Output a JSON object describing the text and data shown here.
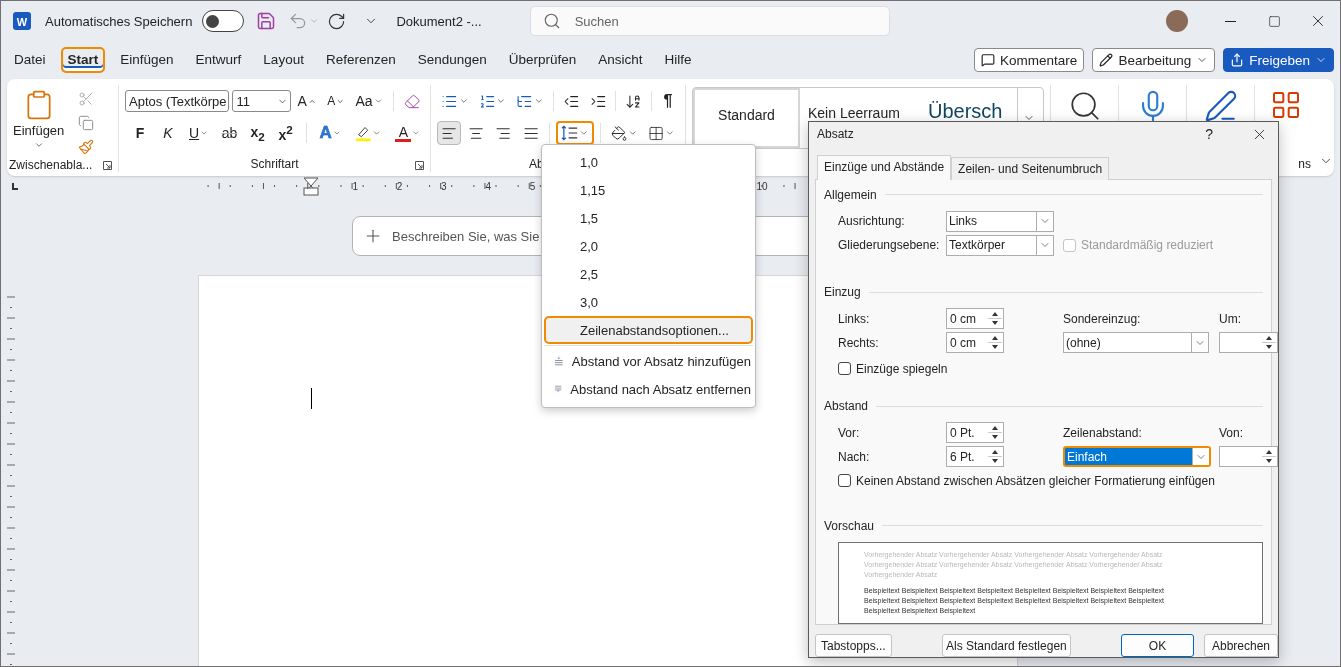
{
  "title_bar": {
    "logo_letter": "W",
    "autosave_label": "Automatisches Speichern",
    "autosave_on": false,
    "document_title": "Dokument2 -...",
    "search_placeholder": "Suchen"
  },
  "tabs": [
    {
      "label": "Datei",
      "selected": false,
      "highlighted": false
    },
    {
      "label": "Start",
      "selected": true,
      "highlighted": true
    },
    {
      "label": "Einfügen",
      "selected": false,
      "highlighted": false
    },
    {
      "label": "Entwurf",
      "selected": false,
      "highlighted": false
    },
    {
      "label": "Layout",
      "selected": false,
      "highlighted": false
    },
    {
      "label": "Referenzen",
      "selected": false,
      "highlighted": false
    },
    {
      "label": "Sendungen",
      "selected": false,
      "highlighted": false
    },
    {
      "label": "Überprüfen",
      "selected": false,
      "highlighted": false
    },
    {
      "label": "Ansicht",
      "selected": false,
      "highlighted": false
    },
    {
      "label": "Hilfe",
      "selected": false,
      "highlighted": false
    }
  ],
  "actions": [
    {
      "label": "Kommentare",
      "kind": "comment"
    },
    {
      "label": "Bearbeitung",
      "kind": "edit"
    },
    {
      "label": "Freigeben",
      "kind": "share"
    }
  ],
  "clipboard": {
    "paste_label": "Einfügen",
    "group_label": "Zwischenabla..."
  },
  "font": {
    "font_name": "Aptos (Textkörpe",
    "font_size": "11",
    "group_label": "Schriftart",
    "size_buttons": [
      {
        "label": "A",
        "kind": "grow"
      },
      {
        "label": "A",
        "kind": "shrink"
      },
      {
        "label": "Aa",
        "kind": "case"
      }
    ],
    "format_buttons": [
      {
        "label": "F",
        "kind": "bold"
      },
      {
        "label": "K",
        "kind": "italic"
      },
      {
        "label": "U",
        "kind": "underline"
      },
      {
        "label": "ab",
        "kind": "strike"
      },
      {
        "label": "x$_{2}$",
        "kind": "script"
      },
      {
        "label": "x$^{2}$",
        "kind": "script"
      }
    ],
    "color_buttons": [
      {
        "label": "A",
        "kind": "effects"
      },
      {
        "kind": "highlight",
        "color": "#ffef00"
      },
      {
        "label": "A",
        "kind": "font-color",
        "color": "#e31b1b"
      }
    ]
  },
  "paragraph": {
    "pilcrow": "¶",
    "group_label": "Ab",
    "line_spacing_highlighted": true,
    "alignments": [
      {
        "kind": "left",
        "selected": true
      },
      {
        "kind": "center",
        "selected": false
      },
      {
        "kind": "right",
        "selected": false
      },
      {
        "kind": "justify",
        "selected": false
      }
    ]
  },
  "styles": [
    {
      "label": "Standard",
      "selected": true,
      "kind": "normal"
    },
    {
      "label": "Kein Leerraum",
      "selected": false,
      "kind": "normal"
    },
    {
      "label": "Übersch",
      "selected": false,
      "kind": "heading"
    }
  ],
  "tools": [
    {
      "kind": "search"
    },
    {
      "kind": "dictate"
    },
    {
      "kind": "editor"
    },
    {
      "kind": "addins",
      "group_label": "ns"
    }
  ],
  "ruler": {
    "left_numbers": [
      "1",
      "2",
      "3",
      "4",
      "5"
    ],
    "right_numbers": [
      "10"
    ]
  },
  "prompt": {
    "placeholder": "Beschreiben Sie, was Sie"
  },
  "line_spacing_menu": [
    {
      "label": "1,0",
      "kind": "value",
      "highlighted": false
    },
    {
      "label": "1,15",
      "kind": "value",
      "highlighted": false
    },
    {
      "label": "1,5",
      "kind": "value",
      "highlighted": false
    },
    {
      "label": "2,0",
      "kind": "value",
      "highlighted": false
    },
    {
      "label": "2,5",
      "kind": "value",
      "highlighted": false
    },
    {
      "label": "3,0",
      "kind": "value",
      "highlighted": false
    },
    {
      "label": "Zeilenabstandsoptionen...",
      "kind": "value",
      "highlighted": true
    },
    {
      "label": "Abstand vor Absatz hinzufügen",
      "kind": "add-before",
      "highlighted": false
    },
    {
      "label": "Abstand nach Absatz entfernen",
      "kind": "remove-after",
      "highlighted": false
    }
  ],
  "dialog": {
    "title": "Absatz",
    "help": "?",
    "tabs": [
      {
        "label": "Einzüge und Abstände",
        "selected": true
      },
      {
        "label": "Zeilen- und Seitenumbruch",
        "selected": false
      }
    ],
    "general": {
      "heading": "Allgemein",
      "alignment": {
        "label": "Ausrichtung:",
        "value": "Links"
      },
      "outline": {
        "label": "Gliederungsebene:",
        "value": "Textkörper"
      },
      "collapsed": {
        "label": "Standardmäßig reduziert",
        "checked": false,
        "disabled": true
      }
    },
    "indent": {
      "heading": "Einzug",
      "left": {
        "label": "Links:",
        "value": "0 cm"
      },
      "right": {
        "label": "Rechts:",
        "value": "0 cm"
      },
      "special": {
        "label": "Sondereinzug:",
        "value": "(ohne)"
      },
      "by": {
        "label": "Um:"
      },
      "mirror": {
        "label": "Einzüge spiegeln",
        "checked": false
      }
    },
    "spacing": {
      "heading": "Abstand",
      "before": {
        "label": "Vor:",
        "value": "0 Pt."
      },
      "after": {
        "label": "Nach:",
        "value": "6 Pt."
      },
      "line": {
        "label": "Zeilenabstand:",
        "value": "Einfach",
        "highlighted": true
      },
      "at": {
        "label": "Von:"
      },
      "no_space": {
        "label": "Keinen Abstand zwischen Absätzen gleicher Formatierung einfügen",
        "checked": false
      }
    },
    "preview": {
      "heading": "Vorschau",
      "previous_lines": [
        "Vorhergehender Absatz Vorhergehender Absatz Vorhergehender Absatz Vorhergehender Absatz",
        "Vorhergehender Absatz Vorhergehender Absatz Vorhergehender Absatz Vorhergehender Absatz",
        "Vorhergehender Absatz"
      ],
      "sample_lines": [
        "Beispieltext Beispieltext Beispieltext Beispieltext Beispieltext Beispieltext Beispieltext Beispieltext",
        "Beispieltext Beispieltext Beispieltext Beispieltext Beispieltext Beispieltext Beispieltext Beispieltext",
        "Beispieltext Beispieltext Beispieltext"
      ]
    },
    "buttons": [
      {
        "label": "Tabstopps...",
        "kind": "secondary"
      },
      {
        "label": "Als Standard festlegen",
        "kind": "secondary"
      },
      {
        "label": "OK",
        "kind": "default"
      },
      {
        "label": "Abbrechen",
        "kind": "secondary"
      }
    ]
  }
}
